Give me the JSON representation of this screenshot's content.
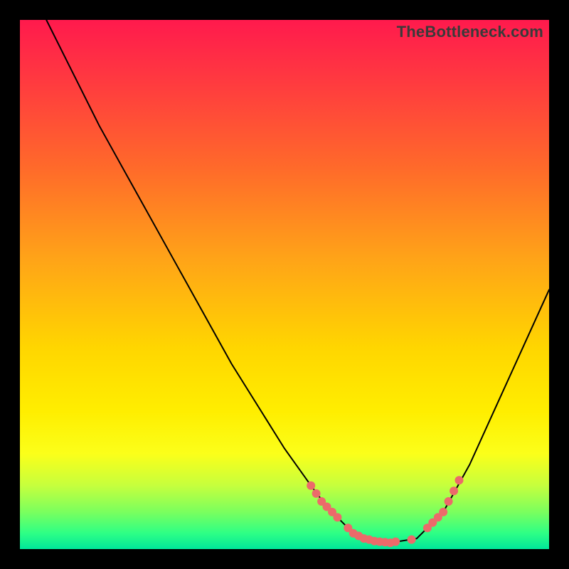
{
  "watermark": "TheBottleneck.com",
  "chart_data": {
    "type": "line",
    "title": "",
    "xlabel": "",
    "ylabel": "",
    "xlim": [
      0,
      100
    ],
    "ylim": [
      0,
      100
    ],
    "grid": false,
    "legend": false,
    "series": [
      {
        "name": "bottleneck-curve",
        "x": [
          5,
          10,
          15,
          20,
          25,
          30,
          35,
          40,
          45,
          50,
          55,
          58,
          60,
          62,
          64,
          66,
          68,
          70,
          75,
          80,
          85,
          90,
          95,
          100
        ],
        "y": [
          100,
          90,
          80,
          71,
          62,
          53,
          44,
          35,
          27,
          19,
          12,
          8,
          6,
          4,
          2.5,
          1.8,
          1.4,
          1.2,
          2,
          7,
          16,
          27,
          38,
          49
        ]
      }
    ],
    "highlight_points": {
      "name": "highlight-dots",
      "values": [
        {
          "x": 55,
          "y": 12
        },
        {
          "x": 56,
          "y": 10.5
        },
        {
          "x": 57,
          "y": 9
        },
        {
          "x": 58,
          "y": 8
        },
        {
          "x": 59,
          "y": 7
        },
        {
          "x": 60,
          "y": 6
        },
        {
          "x": 62,
          "y": 4
        },
        {
          "x": 63,
          "y": 3
        },
        {
          "x": 64,
          "y": 2.5
        },
        {
          "x": 65,
          "y": 2
        },
        {
          "x": 66,
          "y": 1.8
        },
        {
          "x": 67,
          "y": 1.5
        },
        {
          "x": 68,
          "y": 1.4
        },
        {
          "x": 69,
          "y": 1.3
        },
        {
          "x": 70,
          "y": 1.2
        },
        {
          "x": 71,
          "y": 1.4
        },
        {
          "x": 74,
          "y": 1.8
        },
        {
          "x": 77,
          "y": 4
        },
        {
          "x": 78,
          "y": 5
        },
        {
          "x": 79,
          "y": 6
        },
        {
          "x": 80,
          "y": 7
        },
        {
          "x": 81,
          "y": 9
        },
        {
          "x": 82,
          "y": 11
        },
        {
          "x": 83,
          "y": 13
        }
      ]
    },
    "background_gradient": {
      "top": "#ff1a4d",
      "mid": "#ffd600",
      "bottom": "#00e69a"
    }
  }
}
